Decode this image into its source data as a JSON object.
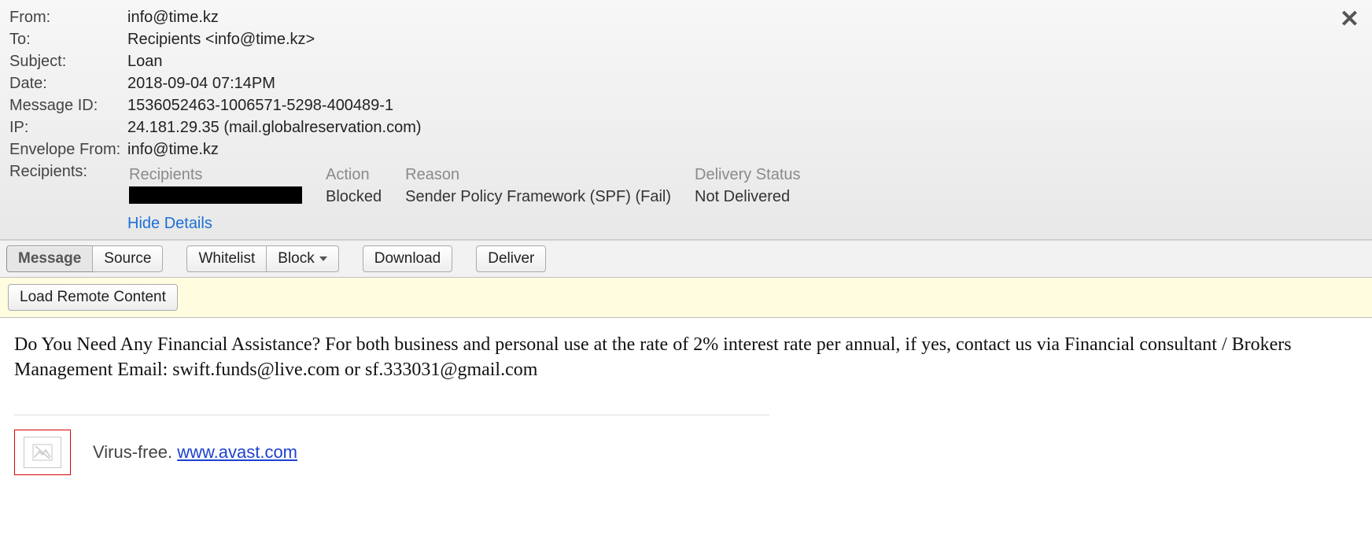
{
  "header": {
    "labels": {
      "from": "From:",
      "to": "To:",
      "subject": "Subject:",
      "date": "Date:",
      "message_id": "Message ID:",
      "ip": "IP:",
      "envelope_from": "Envelope From:",
      "recipients": "Recipients:"
    },
    "from": "info@time.kz",
    "to": "Recipients <info@time.kz>",
    "subject": "Loan",
    "date": "2018-09-04 07:14PM",
    "message_id": "1536052463-1006571-5298-400489-1",
    "ip": "24.181.29.35 (mail.globalreservation.com)",
    "envelope_from": "info@time.kz",
    "recipients_table": {
      "headers": {
        "recipients": "Recipients",
        "action": "Action",
        "reason": "Reason",
        "delivery_status": "Delivery Status"
      },
      "rows": [
        {
          "recipient_redacted": true,
          "action": "Blocked",
          "reason": "Sender Policy Framework (SPF) (Fail)",
          "delivery_status": "Not Delivered"
        }
      ]
    },
    "hide_details": "Hide Details"
  },
  "toolbar": {
    "message": "Message",
    "source": "Source",
    "whitelist": "Whitelist",
    "block": "Block",
    "download": "Download",
    "deliver": "Deliver"
  },
  "remote_bar": {
    "load_remote": "Load Remote Content"
  },
  "body": {
    "text": "Do You Need Any Financial Assistance? For both business and personal use at the rate of 2% interest rate per annual, if yes, contact us via Financial consultant / Brokers Management Email: swift.funds@live.com or sf.333031@gmail.com"
  },
  "signature": {
    "virus_free": "Virus-free. ",
    "avast_link": "www.avast.com"
  }
}
